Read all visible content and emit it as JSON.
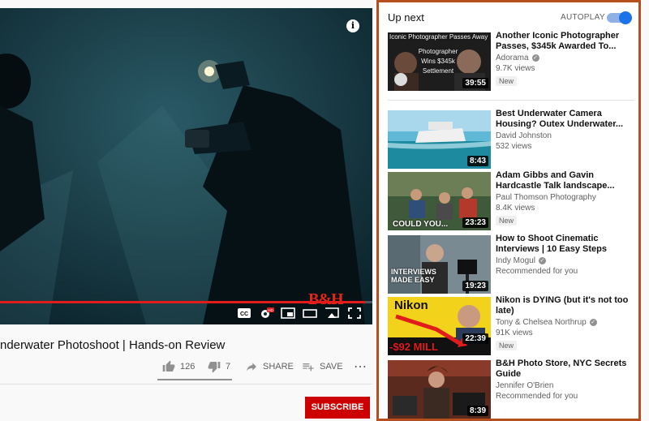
{
  "player": {
    "info_icon": "info-icon",
    "watermark": "B&H",
    "progress_fraction": 0.98,
    "controls": [
      "captions-icon",
      "settings-hd-icon",
      "miniplayer-icon",
      "theater-icon",
      "cast-icon",
      "fullscreen-icon"
    ]
  },
  "video": {
    "title": "nderwater Photoshoot | Hands-on Review",
    "likes": "126",
    "dislikes": "7",
    "share_label": "SHARE",
    "save_label": "SAVE",
    "more_icon": "more-horizontal-icon",
    "subscribe_label": "SUBSCRIBE"
  },
  "upnext": {
    "title": "Up next",
    "autoplay_label": "AUTOPLAY",
    "autoplay_on": true,
    "items": [
      {
        "title": "Another Iconic Photographer Passes, $345k Awarded To...",
        "channel": "Adorama",
        "verified": true,
        "views": "9.7K views",
        "badge": "New",
        "duration": "39:55",
        "thumb_caption": "Iconic Photographer Passes Away",
        "thumb_caption2": "Photographer Wins $345k Settlement"
      },
      {
        "title": "Best Underwater Camera Housing? Outex Underwater...",
        "channel": "David Johnston",
        "verified": false,
        "views": "532 views",
        "badge": "",
        "duration": "8:43",
        "thumb_caption": "",
        "thumb_caption2": ""
      },
      {
        "title": "Adam Gibbs and Gavin Hardcastle Talk landscape...",
        "channel": "Paul Thomson Photography",
        "verified": false,
        "views": "8.4K views",
        "badge": "New",
        "duration": "23:23",
        "thumb_caption": "COULD YOU...",
        "thumb_caption2": ""
      },
      {
        "title": "How to Shoot Cinematic Interviews | 10 Easy Steps",
        "channel": "Indy Mogul",
        "verified": true,
        "views": "Recommended for you",
        "badge": "",
        "duration": "19:23",
        "thumb_caption": "INTERVIEWS MADE EASY",
        "thumb_caption2": ""
      },
      {
        "title": "Nikon is DYING (but it's not too late)",
        "channel": "Tony & Chelsea Northrup",
        "verified": true,
        "views": "91K views",
        "badge": "New",
        "duration": "22:39",
        "thumb_caption": "Nikon",
        "thumb_caption2": "-$92 MILL"
      },
      {
        "title": "B&H Photo Store, NYC Secrets Guide",
        "channel": "Jennifer O'Brien",
        "verified": false,
        "views": "Recommended for you",
        "badge": "",
        "duration": "8:39",
        "thumb_caption": "",
        "thumb_caption2": ""
      }
    ]
  },
  "colors": {
    "accent_red": "#cc0000",
    "autoplay_blue": "#1a73e8",
    "panel_border": "#b5501e"
  }
}
